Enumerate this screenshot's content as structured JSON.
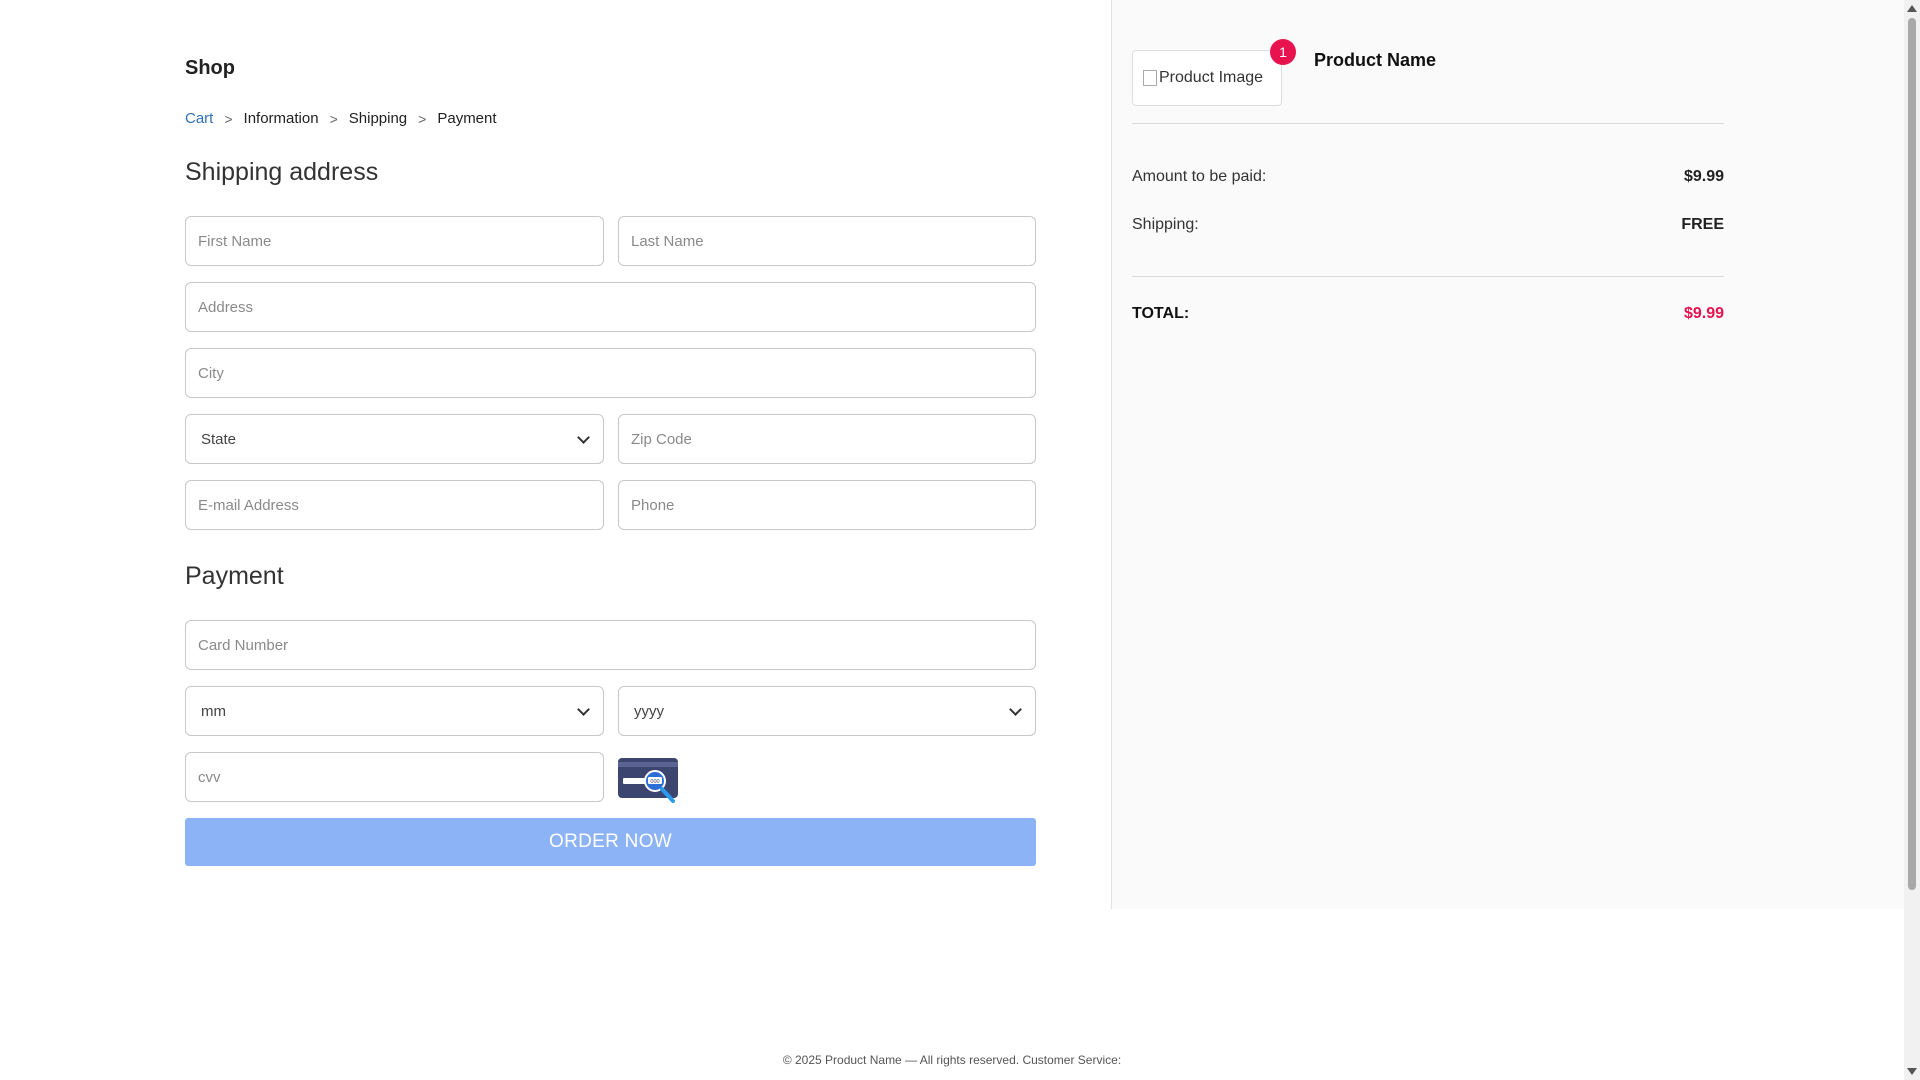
{
  "header": {
    "brand": "Shop"
  },
  "breadcrumb": {
    "cart": "Cart",
    "sep": ">",
    "information": "Information",
    "shipping": "Shipping",
    "payment": "Payment"
  },
  "shipping_form": {
    "heading": "Shipping address",
    "first_name_placeholder": "First Name",
    "last_name_placeholder": "Last Name",
    "address_placeholder": "Address",
    "city_placeholder": "City",
    "state_selected": "State",
    "zip_placeholder": "Zip Code",
    "email_placeholder": "E-mail Address",
    "phone_placeholder": "Phone"
  },
  "payment_form": {
    "heading": "Payment",
    "card_number_placeholder": "Card Number",
    "month_selected": "mm",
    "year_selected": "yyyy",
    "cvv_placeholder": "cvv",
    "card_icon": "credit-card-cvv-icon",
    "order_button": "ORDER NOW",
    "order_button_color": "#8cb3f5"
  },
  "summary": {
    "product_image_alt": "Product Image",
    "quantity_badge": "1",
    "product_name": "Product Name",
    "amount_label": "Amount to be paid:",
    "amount_value": "$9.99",
    "shipping_label": "Shipping:",
    "shipping_value": "FREE",
    "total_label": "TOTAL:",
    "total_value": "$9.99",
    "accent_color": "#e8124f"
  },
  "footer": {
    "copyright": "© 2025 Product Name — All rights reserved.",
    "customer_service": "Customer Service:"
  }
}
